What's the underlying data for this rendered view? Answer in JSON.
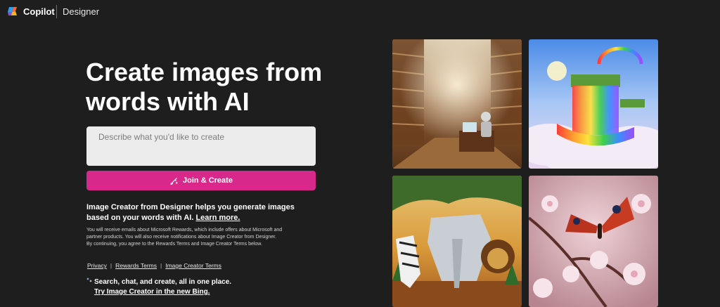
{
  "header": {
    "brand": "Copilot",
    "product": "Designer"
  },
  "main": {
    "headline": "Create images from words with AI",
    "prompt_placeholder": "Describe what you'd like to create",
    "join_button": "Join & Create",
    "info_text": "Image Creator from Designer helps you generate images based on your words with AI.",
    "learn_more": "Learn more.",
    "fine_print": "You will receive emails about Microsoft Rewards, which include offers about Microsoft and partner products. You will also receive notifications about Image Creator from Designer. By continuing, you agree to the Rewards Terms and Image Creator Terms below.",
    "links": [
      "Privacy",
      "Rewards Terms",
      "Image Creator Terms"
    ],
    "link_separator": "|",
    "promo_line1": "Search, chat, and create, all in one place.",
    "promo_line2": "Try Image Creator in the new Bing."
  },
  "gallery": {
    "images": [
      {
        "name": "robot-library-image"
      },
      {
        "name": "rainbow-waterfall-image"
      },
      {
        "name": "papercraft-animals-image"
      },
      {
        "name": "butterfly-blossom-image"
      }
    ]
  },
  "colors": {
    "background": "#1f1e1e",
    "accent": "#d9288b",
    "input_bg": "#ececec"
  }
}
